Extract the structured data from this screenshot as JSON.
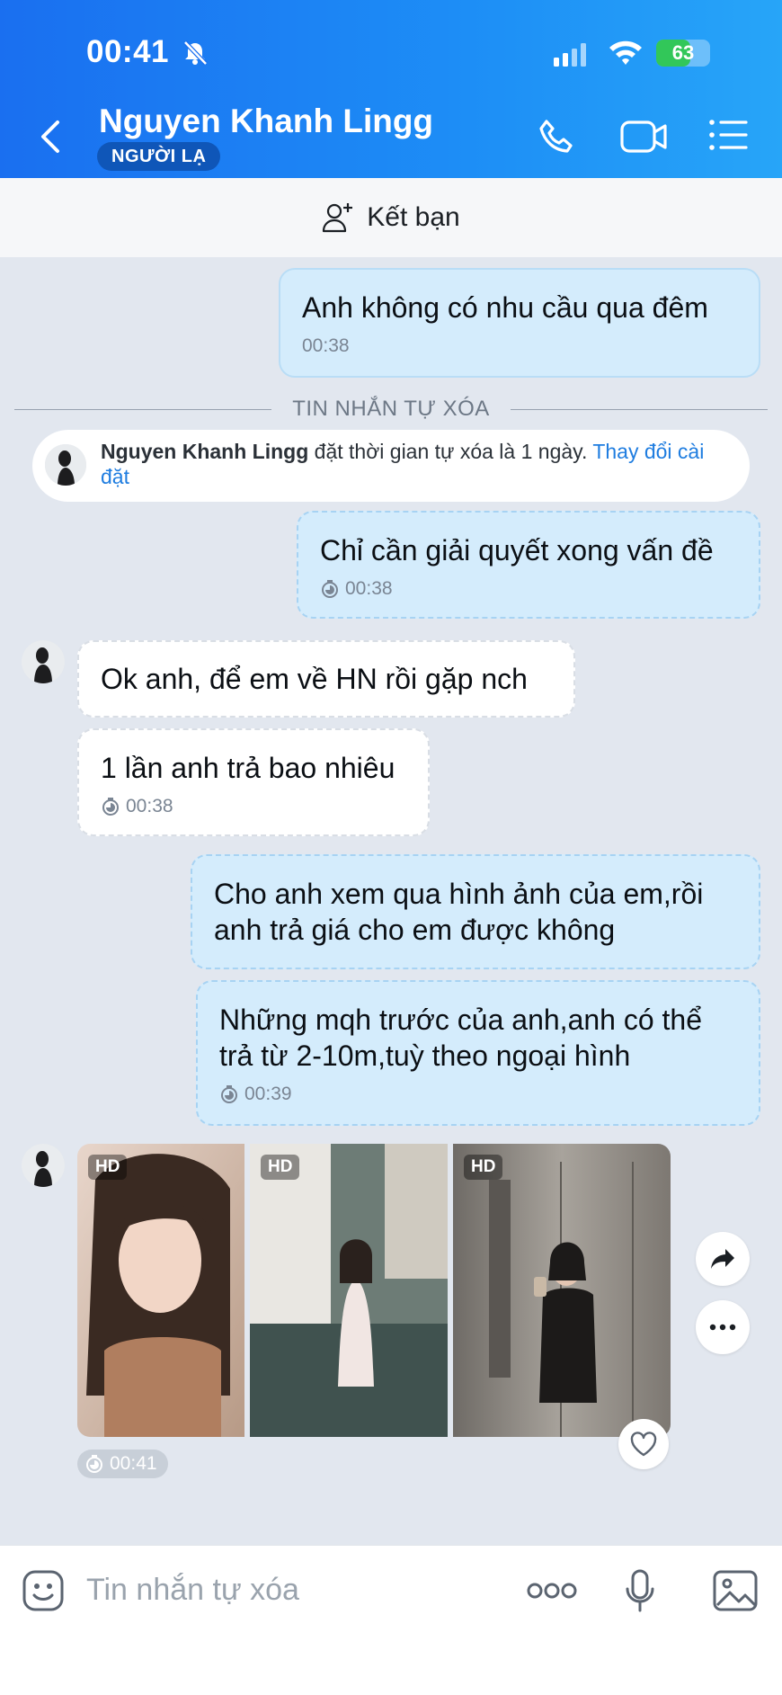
{
  "status_bar": {
    "time": "00:41",
    "battery": "63",
    "battery_level": 0.63
  },
  "header": {
    "name": "Nguyen Khanh Lingg",
    "badge": "NGƯỜI LẠ"
  },
  "add_friend": {
    "label": "Kết bạn"
  },
  "messages": {
    "m1": {
      "text": "Anh không có nhu cầu qua đêm",
      "time": "00:38"
    },
    "divider": "TIN NHẮN TỰ XÓA",
    "notice": {
      "name": "Nguyen Khanh Lingg",
      "text": " đặt thời gian tự xóa là 1 ngày. ",
      "link": "Thay đổi cài đặt"
    },
    "m2": {
      "text": "Chỉ cần giải quyết xong vấn đề",
      "time": "00:38"
    },
    "m3": {
      "text": "Ok anh, để em về HN rồi gặp nch"
    },
    "m4": {
      "text": "1 lần anh trả bao nhiêu",
      "time": "00:38"
    },
    "m5": {
      "text": "Cho anh xem qua hình ảnh của em,rồi anh trả giá cho em được không"
    },
    "m6": {
      "text": "Những mqh trước của anh,anh có thể trả từ 2-10m,tuỳ theo ngoại hình",
      "time": "00:39"
    },
    "photos": {
      "badges": [
        "HD",
        "HD",
        "HD"
      ],
      "time": "00:41"
    }
  },
  "composer": {
    "placeholder": "Tin nhắn tự xóa"
  },
  "colors": {
    "header_start": "#1a6ff0",
    "sent_bubble": "#d4ecfc",
    "link": "#1f7de0"
  }
}
